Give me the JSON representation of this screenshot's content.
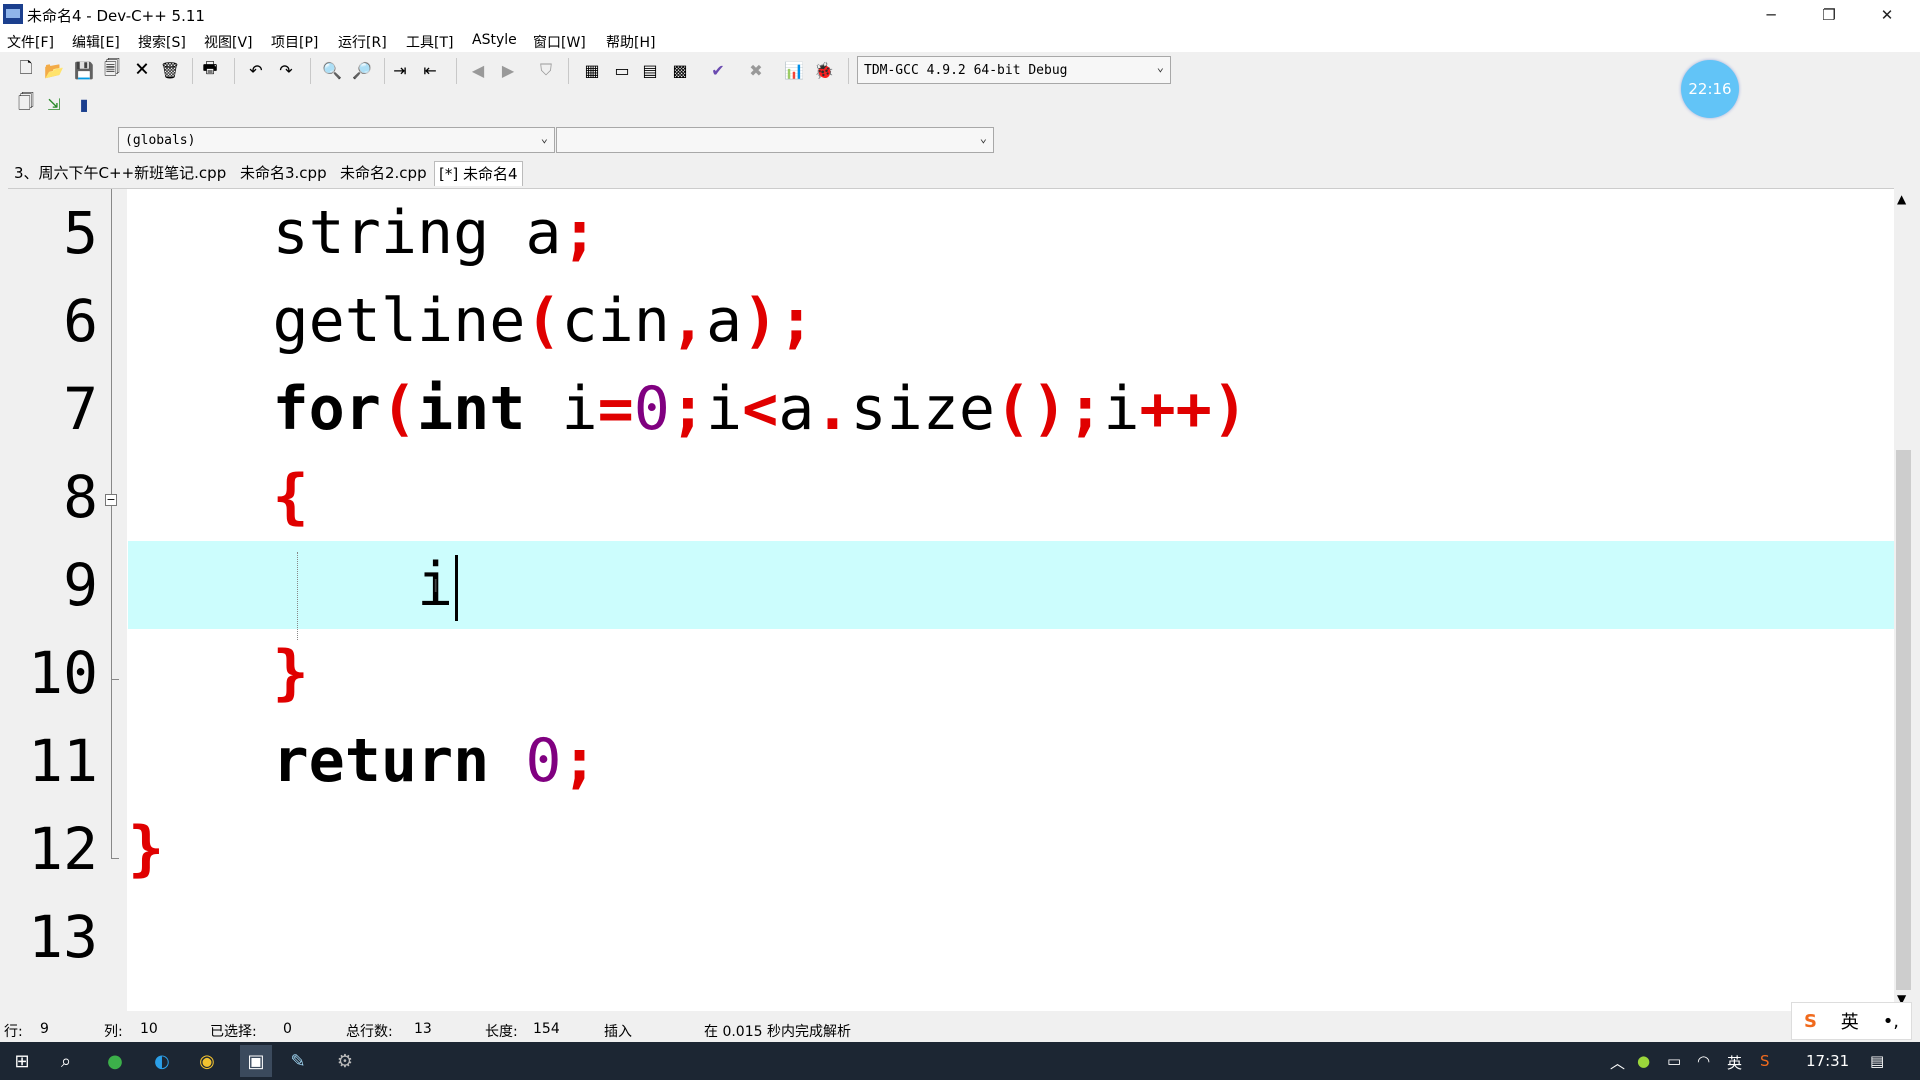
{
  "window": {
    "title": "未命名4 - Dev-C++ 5.11"
  },
  "menu": [
    "文件[F]",
    "编辑[E]",
    "搜索[S]",
    "视图[V]",
    "项目[P]",
    "运行[R]",
    "工具[T]",
    "AStyle",
    "窗口[W]",
    "帮助[H]"
  ],
  "toolbar": {
    "compiler_select": "TDM-GCC 4.9.2 64-bit Debug",
    "scope_select": "(globals)",
    "member_select": ""
  },
  "timer": {
    "value": "22:16"
  },
  "tabs": [
    {
      "label": "3、周六下午C++新班笔记.cpp"
    },
    {
      "label": "未命名3.cpp"
    },
    {
      "label": "未命名2.cpp"
    },
    {
      "label": "[*] 未命名4"
    }
  ],
  "editor": {
    "line_numbers": [
      "5",
      "6",
      "7",
      "8",
      "9",
      "10",
      "11",
      "12",
      "13"
    ],
    "current_line": "9",
    "lines": [
      {
        "tokens": [
          "string a",
          ";"
        ]
      },
      {
        "tokens": [
          "getline",
          "(",
          "cin",
          ",",
          "a",
          ")",
          ";"
        ]
      },
      {
        "tokens": [
          "for",
          "(",
          "int",
          " i",
          "=",
          "0",
          ";",
          "i",
          "<",
          "a",
          ".",
          "size",
          "()",
          ";",
          "i",
          "++",
          ")"
        ]
      },
      {
        "tokens": [
          "{"
        ]
      },
      {
        "tokens": [
          "i"
        ]
      },
      {
        "tokens": [
          "}"
        ]
      },
      {
        "tokens": [
          "return",
          " ",
          "0",
          ";"
        ]
      },
      {
        "tokens": [
          "}"
        ]
      }
    ]
  },
  "status": {
    "row_label": "行:",
    "row_value": "9",
    "col_label": "列:",
    "col_value": "10",
    "sel_label": "已选择:",
    "sel_value": "0",
    "lines_label": "总行数:",
    "lines_value": "13",
    "len_label": "长度:",
    "len_value": "154",
    "mode": "插入",
    "message": "在 0.015 秒内完成解析"
  },
  "ime": {
    "lang": "英"
  },
  "taskbar": {
    "clock": "17:31",
    "tray_lang": "英"
  },
  "colors": {
    "symbol": "#e00000",
    "number": "#800080",
    "current_line": "#ccfdfd",
    "timer": "#62c4f7"
  }
}
